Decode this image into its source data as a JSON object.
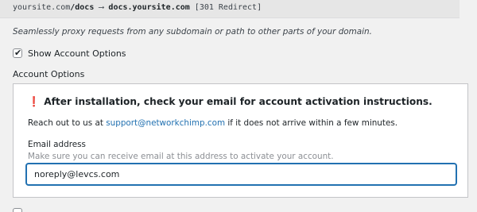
{
  "proxy_example": {
    "clipped_line": "yoursite.com/docs ⟶ docs.yoursite.com [301 Redirect]",
    "source": "yoursite.com",
    "source_path": "/docs",
    "arrow": " ⟶ ",
    "target": "docs.yoursite.com",
    "status": " [301 Redirect]"
  },
  "description": "Seamlessly proxy requests from any subdomain or path to other parts of your domain.",
  "show_account_options": {
    "label": "Show Account Options",
    "checked": true,
    "check_glyph": "✔"
  },
  "account_options": {
    "section_label": "Account Options",
    "notice_icon": "❗",
    "notice": "After installation, check your email for account activation instructions.",
    "reach_prefix": "Reach out to us at ",
    "support_email": "support@networkchimp.com",
    "reach_suffix": " if it does not arrive within a few minutes.",
    "email_label": "Email address",
    "email_help": "Make sure you can receive email at this address to activate your account.",
    "email_value": "noreply@levcs.com"
  }
}
